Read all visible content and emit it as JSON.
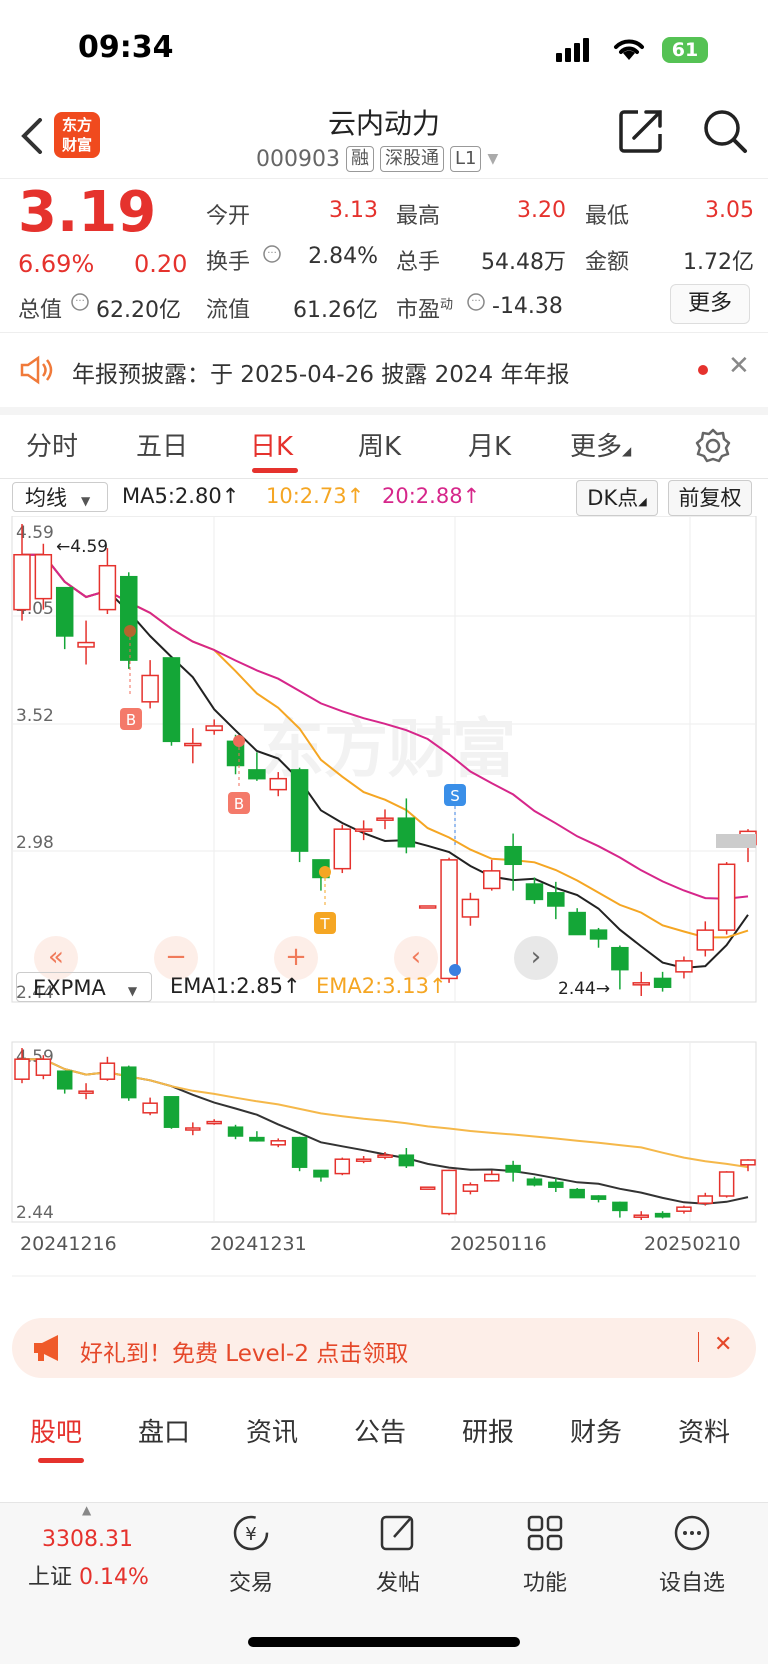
{
  "status_bar": {
    "time": "09:34",
    "battery": "61"
  },
  "header": {
    "back_icon": "chevron-left-icon",
    "logo_text_1": "东方",
    "logo_text_2": "财富",
    "stock_name": "云内动力",
    "stock_code": "000903",
    "tags": [
      "融",
      "深股通",
      "L1"
    ],
    "share_icon": "share-icon",
    "search_icon": "search-icon"
  },
  "quote": {
    "price": "3.19",
    "change_pct": "6.69%",
    "change_amt": "0.20",
    "open_label": "今开",
    "open": "3.13",
    "high_label": "最高",
    "high": "3.20",
    "low_label": "最低",
    "low": "3.05",
    "turnover_label": "换手",
    "turnover": "2.84%",
    "volume_label": "总手",
    "volume": "54.48万",
    "amount_label": "金额",
    "amount": "1.72亿",
    "mktcap_label": "总值",
    "mktcap": "62.20亿",
    "float_label": "流值",
    "float": "61.26亿",
    "pe_label": "市盈",
    "pe_sup": "动",
    "pe": "-14.38",
    "more_button": "更多"
  },
  "notice": {
    "text": "年报预披露：于 2025-04-26 披露 2024 年年报"
  },
  "tabs": {
    "items": [
      "分时",
      "五日",
      "日K",
      "周K",
      "月K",
      "更多"
    ],
    "active": "日K"
  },
  "indicator_bar": {
    "type": "均线",
    "ma5": "MA5:2.80",
    "ma10": "10:2.73",
    "ma20": "20:2.88",
    "dk_button": "DK点",
    "adjust_button": "前复权"
  },
  "main_chart": {
    "y_ticks": [
      "4.59",
      "4.05",
      "3.52",
      "2.98",
      "2.44"
    ],
    "max_marker": "4.59",
    "min_marker": "2.44",
    "watermark": "东方财富",
    "markers": [
      "B",
      "B",
      "T",
      "S"
    ]
  },
  "sub_indicator_bar": {
    "type": "EXPMA",
    "ema1": "EMA1:2.85",
    "ema2": "EMA2:3.13"
  },
  "sub_chart": {
    "y_top": "4.59",
    "y_bottom": "2.44"
  },
  "x_dates": [
    "20241216",
    "20241231",
    "20250116",
    "20250210"
  ],
  "chart_data": {
    "type": "candlestick",
    "dates_shown": [
      "20241216",
      "20241231",
      "20250116",
      "20250210"
    ],
    "ylim": [
      2.44,
      4.59
    ],
    "candles": [
      {
        "o": 4.2,
        "c": 4.45,
        "h": 4.59,
        "l": 4.15
      },
      {
        "o": 4.25,
        "c": 4.45,
        "h": 4.5,
        "l": 4.2
      },
      {
        "o": 4.3,
        "c": 4.08,
        "h": 4.3,
        "l": 4.02
      },
      {
        "o": 4.03,
        "c": 4.05,
        "h": 4.15,
        "l": 3.95
      },
      {
        "o": 4.2,
        "c": 4.4,
        "h": 4.48,
        "l": 4.18
      },
      {
        "o": 4.35,
        "c": 3.97,
        "h": 4.37,
        "l": 3.93
      },
      {
        "o": 3.78,
        "c": 3.9,
        "h": 3.97,
        "l": 3.75
      },
      {
        "o": 3.98,
        "c": 3.6,
        "h": 3.98,
        "l": 3.58
      },
      {
        "o": 3.59,
        "c": 3.59,
        "h": 3.66,
        "l": 3.5
      },
      {
        "o": 3.65,
        "c": 3.67,
        "h": 3.7,
        "l": 3.63
      },
      {
        "o": 3.6,
        "c": 3.49,
        "h": 3.63,
        "l": 3.45
      },
      {
        "o": 3.47,
        "c": 3.43,
        "h": 3.55,
        "l": 3.42
      },
      {
        "o": 3.38,
        "c": 3.43,
        "h": 3.46,
        "l": 3.35
      },
      {
        "o": 3.47,
        "c": 3.1,
        "h": 3.48,
        "l": 3.05
      },
      {
        "o": 3.06,
        "c": 2.98,
        "h": 3.06,
        "l": 2.92
      },
      {
        "o": 3.02,
        "c": 3.2,
        "h": 3.22,
        "l": 3.0
      },
      {
        "o": 3.2,
        "c": 3.2,
        "h": 3.24,
        "l": 3.15
      },
      {
        "o": 3.25,
        "c": 3.25,
        "h": 3.29,
        "l": 3.2
      },
      {
        "o": 3.25,
        "c": 3.12,
        "h": 3.34,
        "l": 3.09
      },
      {
        "o": 2.85,
        "c": 2.85,
        "h": 2.85,
        "l": 2.85
      },
      {
        "o": 2.52,
        "c": 3.06,
        "h": 3.07,
        "l": 2.5
      },
      {
        "o": 2.8,
        "c": 2.88,
        "h": 2.91,
        "l": 2.76
      },
      {
        "o": 2.93,
        "c": 3.01,
        "h": 3.06,
        "l": 2.92
      },
      {
        "o": 3.12,
        "c": 3.04,
        "h": 3.18,
        "l": 2.92
      },
      {
        "o": 2.95,
        "c": 2.88,
        "h": 2.98,
        "l": 2.86
      },
      {
        "o": 2.91,
        "c": 2.85,
        "h": 2.96,
        "l": 2.79
      },
      {
        "o": 2.82,
        "c": 2.72,
        "h": 2.84,
        "l": 2.72
      },
      {
        "o": 2.74,
        "c": 2.7,
        "h": 2.75,
        "l": 2.66
      },
      {
        "o": 2.66,
        "c": 2.56,
        "h": 2.67,
        "l": 2.47
      },
      {
        "o": 2.5,
        "c": 2.5,
        "h": 2.55,
        "l": 2.44
      },
      {
        "o": 2.52,
        "c": 2.48,
        "h": 2.55,
        "l": 2.46
      },
      {
        "o": 2.55,
        "c": 2.6,
        "h": 2.62,
        "l": 2.52
      },
      {
        "o": 2.65,
        "c": 2.74,
        "h": 2.78,
        "l": 2.62
      },
      {
        "o": 2.74,
        "c": 3.04,
        "h": 3.05,
        "l": 2.72
      },
      {
        "o": 3.13,
        "c": 3.19,
        "h": 3.2,
        "l": 3.05
      }
    ]
  }
}
